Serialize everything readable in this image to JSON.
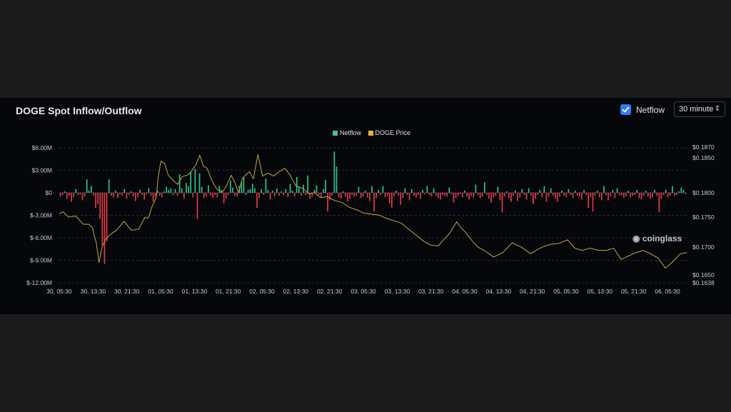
{
  "header": {
    "title": "DOGE Spot Inflow/Outflow",
    "netflow_toggle_label": "Netflow",
    "netflow_checked": true,
    "interval_value": "30 minute"
  },
  "watermark": "coinglass",
  "colors": {
    "background": "#05070b",
    "inflow": "#2ec28b",
    "outflow": "#e23a44",
    "price": "#b39a3c",
    "accent": "#2f7cf6"
  },
  "chart_data": {
    "type": "bar",
    "legend": [
      {
        "name": "Netflow",
        "color": "#4cc28a"
      },
      {
        "name": "DOGE Price",
        "color": "#e4b53a"
      }
    ],
    "x_tick_labels": [
      "30, 05:30",
      "30, 13:30",
      "30, 21:30",
      "01, 05:30",
      "01, 13:30",
      "01, 21:30",
      "02, 05:30",
      "02, 13:30",
      "02, 21:30",
      "03, 05:30",
      "03, 13:30",
      "03, 21:30",
      "04, 05:30",
      "04, 13:30",
      "04, 21:30",
      "05, 05:30",
      "05, 13:30",
      "05, 21:30",
      "06, 05:30"
    ],
    "left_axis": {
      "ticks": [
        6,
        3,
        0,
        -3,
        -6,
        -9,
        -12
      ],
      "tick_labels": [
        "$6.00M",
        "$3.00M",
        "$0",
        "$-3.00M",
        "$-6.00M",
        "$-9.00M",
        "$-12.00M"
      ],
      "range": [
        -12,
        6
      ],
      "unit": "M USD"
    },
    "right_axis": {
      "ticks": [
        0.187,
        0.185,
        0.18,
        0.175,
        0.17,
        0.165,
        0.1638
      ],
      "tick_labels": [
        "$0.1870",
        "$0.1850",
        "$0.1800",
        "$0.1750",
        "$0.1700",
        "$0.1650",
        "$0.1638"
      ],
      "range": [
        0.1638,
        0.187
      ]
    },
    "grid": true,
    "series": [
      {
        "name": "Netflow",
        "values": [
          -0.5,
          -0.3,
          0.2,
          -0.8,
          -0.4,
          -1.2,
          -0.6,
          0.5,
          -0.3,
          -0.2,
          -1.0,
          -0.5,
          1.8,
          0.3,
          0.9,
          -0.4,
          -2.0,
          -1.5,
          -3.5,
          -7.0,
          -9.5,
          -6.5,
          1.8,
          -0.4,
          -0.6,
          0.3,
          -0.7,
          -0.2,
          -0.4,
          0.5,
          -0.8,
          -0.3,
          0.2,
          -0.5,
          -1.1,
          -0.6,
          0.4,
          -0.3,
          -0.9,
          -0.2,
          0.6,
          -0.4,
          -1.2,
          -0.5,
          0.3,
          -0.4,
          -0.6,
          0.2,
          0.8,
          0.4,
          0.6,
          -0.3,
          0.5,
          -0.4,
          2.5,
          0.6,
          -0.8,
          1.3,
          0.9,
          2.8,
          -0.6,
          3.2,
          -3.5,
          2.6,
          0.8,
          -0.7,
          -0.5,
          1.0,
          -0.4,
          -0.7,
          -0.3,
          -0.6,
          0.9,
          0.4,
          -1.4,
          -0.8,
          -0.3,
          1.6,
          0.7,
          -0.4,
          -0.5,
          0.9,
          1.5,
          2.1,
          -0.3,
          0.4,
          0.5,
          1.2,
          0.6,
          -2.0,
          -0.7,
          0.5,
          -0.3,
          1.9,
          0.4,
          -0.9,
          0.3,
          -0.5,
          0.6,
          -0.4,
          0.2,
          -0.3,
          0.5,
          -0.6,
          1.2,
          0.3,
          -0.5,
          2.1,
          0.8,
          -0.4,
          1.1,
          -0.3,
          2.3,
          -0.8,
          -0.5,
          0.4,
          1.0,
          -0.3,
          -0.6,
          0.5,
          1.7,
          -2.5,
          -1.0,
          -0.4,
          5.5,
          3.5,
          -0.6,
          -0.8,
          0.2,
          -0.5,
          -1.2,
          -0.8,
          -0.3,
          -0.5,
          -0.4,
          0.8,
          -0.7,
          -0.5,
          0.3,
          -0.6,
          -1.1,
          0.9,
          -2.5,
          -0.7,
          0.4,
          -0.3,
          0.9,
          -0.6,
          -0.4,
          -1.4,
          -2.0,
          -0.5,
          0.3,
          -0.4,
          -1.6,
          -0.7,
          0.6,
          -0.3,
          -1.0,
          0.5,
          -0.4,
          -0.6,
          -0.3,
          -0.8,
          0.4,
          -0.2,
          0.9,
          -0.3,
          -0.5,
          0.6,
          -0.4,
          -0.7,
          -0.9,
          -0.3,
          -0.4,
          -0.5,
          0.7,
          -0.2,
          -1.3,
          -0.7,
          -0.4,
          -0.2,
          -0.6,
          0.3,
          -0.5,
          -0.9,
          -0.4,
          -0.6,
          1.1,
          -0.3,
          -0.7,
          -0.5,
          1.4,
          -0.3,
          -0.8,
          -1.3,
          -0.6,
          -0.4,
          0.8,
          -1.0,
          -2.6,
          -0.5,
          0.2,
          -0.7,
          -1.2,
          -0.4,
          0.3,
          -1.1,
          -0.6,
          0.5,
          -0.3,
          -0.9,
          0.6,
          -0.4,
          -1.5,
          -0.8,
          -0.3,
          0.4,
          -0.6,
          0.9,
          -1.2,
          -0.5,
          0.6,
          -0.4,
          -0.8,
          -1.2,
          -0.5,
          0.3,
          -0.4,
          -0.6,
          0.5,
          -0.3,
          -0.7,
          0.3,
          -0.4,
          -0.5,
          -0.9,
          0.4,
          -0.3,
          -2.0,
          -0.6,
          -2.5,
          -0.4,
          0.3,
          -0.6,
          -1.0,
          0.9,
          -0.3,
          -1.0,
          -0.5,
          0.4,
          -0.7,
          0.6,
          -0.3,
          -0.4,
          -0.7,
          -0.5,
          0.3,
          -0.6,
          -0.4,
          -0.3,
          0.4,
          -0.7,
          -0.9,
          -0.4,
          0.3,
          -0.5,
          -0.8,
          -0.6,
          0.4,
          -0.4,
          -2.6,
          -0.8,
          -0.3,
          0.4,
          -0.6,
          -0.4,
          0.9,
          -0.4,
          -0.3,
          0.2,
          0.7,
          0.4,
          -0.2
        ]
      },
      {
        "name": "DOGE Price",
        "x": [
          0,
          8,
          20,
          36,
          52,
          64,
          72,
          76,
          80,
          86,
          92,
          100,
          112,
          124,
          140,
          156,
          172,
          180,
          186,
          192,
          196,
          200,
          206,
          210,
          214,
          220,
          228,
          236,
          246,
          256,
          266,
          280,
          296,
          304,
          312,
          320,
          330,
          340,
          352,
          362,
          372,
          380,
          388,
          396,
          404,
          412,
          420,
          430,
          440,
          452,
          464,
          476,
          488,
          500,
          512,
          520,
          528,
          540,
          552,
          566,
          580,
          596,
          612,
          628,
          644,
          660,
          676,
          692,
          708,
          724,
          740,
          756,
          772,
          788,
          804,
          820,
          832,
          844,
          860,
          872,
          878,
          886,
          896,
          906,
          920,
          940,
          960,
          980,
          1000,
          1020,
          1040,
          1060,
          1080,
          1100,
          1116,
          1132,
          1148,
          1168,
          1184,
          1200,
          1216,
          1232,
          1248,
          1264,
          1280,
          1296,
          1312,
          1328,
          1344,
          1358
        ],
        "values": [
          0.1757,
          0.1761,
          0.175,
          0.1752,
          0.1738,
          0.1738,
          0.1732,
          0.1718,
          0.1708,
          0.1672,
          0.1698,
          0.1713,
          0.1722,
          0.1728,
          0.1743,
          0.1728,
          0.173,
          0.1742,
          0.175,
          0.1748,
          0.1757,
          0.177,
          0.1782,
          0.179,
          0.1822,
          0.1845,
          0.1842,
          0.1825,
          0.1818,
          0.1812,
          0.1823,
          0.1826,
          0.184,
          0.1855,
          0.1838,
          0.1835,
          0.1818,
          0.1806,
          0.18,
          0.181,
          0.1825,
          0.1815,
          0.18,
          0.182,
          0.1826,
          0.183,
          0.182,
          0.1856,
          0.1824,
          0.1828,
          0.1824,
          0.183,
          0.1835,
          0.1825,
          0.181,
          0.1808,
          0.1806,
          0.1798,
          0.18,
          0.179,
          0.1792,
          0.1784,
          0.178,
          0.177,
          0.1765,
          0.1758,
          0.1756,
          0.1754,
          0.1748,
          0.1744,
          0.174,
          0.173,
          0.172,
          0.171,
          0.1703,
          0.1702,
          0.1712,
          0.1722,
          0.1742,
          0.173,
          0.1726,
          0.1718,
          0.1708,
          0.17,
          0.1694,
          0.1682,
          0.169,
          0.1707,
          0.17,
          0.1688,
          0.1698,
          0.1704,
          0.1706,
          0.1712,
          0.1698,
          0.1694,
          0.1698,
          0.1694,
          0.1694,
          0.1698,
          0.1678,
          0.1684,
          0.169,
          0.1694,
          0.1688,
          0.168,
          0.1662,
          0.1674,
          0.1688,
          0.169
        ]
      }
    ]
  }
}
